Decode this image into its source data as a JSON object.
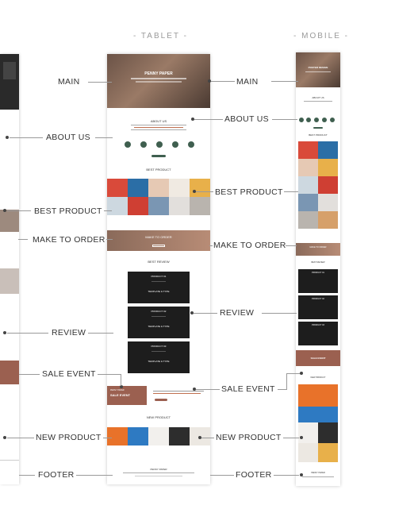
{
  "columns": {
    "tablet": "- TABLET -",
    "mobile": "- MOBILE -"
  },
  "left_labels": [
    "MAIN",
    "ABOUT US",
    "BEST PRODUCT",
    "MAKE TO ORDER",
    "REVIEW",
    "SALE EVENT",
    "NEW PRODUCT",
    "FOOTER"
  ],
  "right_labels": [
    "MAIN",
    "ABOUT US",
    "BEST PRODUCT",
    "MAKE TO ORDER",
    "REVIEW",
    "SALE EVENT",
    "NEW PRODUCT",
    "FOOTER"
  ],
  "tablet": {
    "hero_title": "PENNY PAPER",
    "about_title": "ABOUT US",
    "best_title": "BEST PRODUCT",
    "order_title": "MAKE TO ORDER",
    "review_title": "BEST REVIEW",
    "review_cards": [
      {
        "title": "PRODUCT 01",
        "line": "TEMPLATE & TYPE"
      },
      {
        "title": "PRODUCT 02",
        "line": "TEMPLATE & TYPE"
      },
      {
        "title": "PRODUCT 03",
        "line": "TEMPLATE & TYPE"
      }
    ],
    "sale_small": "PENNY PAPER",
    "sale_title": "SALE EVENT",
    "new_title": "NEW PRODUCT",
    "footer_title": "PENNY PAPER"
  },
  "mobile": {
    "hero_title": "POSTER DESIGN",
    "about_title": "ABOUT US",
    "best_title": "BEST PRODUCT",
    "order_title": "MAKE TO ORDER",
    "review_title": "BEST REVIEW",
    "review_cards": [
      {
        "title": "PRODUCT 01"
      },
      {
        "title": "PRODUCT 02"
      },
      {
        "title": "PRODUCT 03"
      }
    ],
    "sale_title": "SALE EVENT",
    "new_title": "NEW PRODUCT",
    "footer_title": "PENNY PAPER"
  },
  "colors": {
    "accent_green": "#3f5f4f",
    "sale_brown": "#9b6050",
    "dark": "#1d1d1d"
  }
}
